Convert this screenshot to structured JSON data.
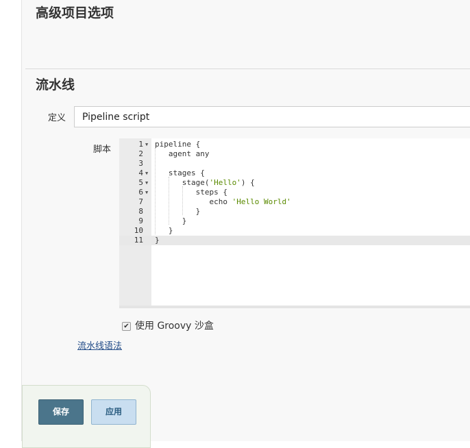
{
  "sections": {
    "advanced_title": "高级项目选项",
    "pipeline_title": "流水线"
  },
  "definition": {
    "label": "定义",
    "selected": "Pipeline script"
  },
  "script": {
    "label": "脚本",
    "lines": [
      {
        "n": "1",
        "text": "pipeline {"
      },
      {
        "n": "2",
        "text": "   agent any"
      },
      {
        "n": "3",
        "text": ""
      },
      {
        "n": "4",
        "text": "   stages {"
      },
      {
        "n": "5",
        "text": "      stage('Hello') {"
      },
      {
        "n": "6",
        "text": "         steps {"
      },
      {
        "n": "7",
        "text": "            echo 'Hello World'"
      },
      {
        "n": "8",
        "text": "         }"
      },
      {
        "n": "9",
        "text": "      }"
      },
      {
        "n": "10",
        "text": "   }"
      },
      {
        "n": "11",
        "text": "}"
      }
    ],
    "foldable_lines": [
      "1",
      "4",
      "5",
      "6"
    ],
    "active_line": "11"
  },
  "sandbox": {
    "label": "使用 Groovy 沙盒",
    "checked": true
  },
  "syntax_link": "流水线语法",
  "buttons": {
    "save": "保存",
    "apply": "应用"
  },
  "colors": {
    "save_bg": "#4b758b",
    "apply_bg": "#c9def0",
    "string": "#5a8a00",
    "link": "#204a87"
  }
}
